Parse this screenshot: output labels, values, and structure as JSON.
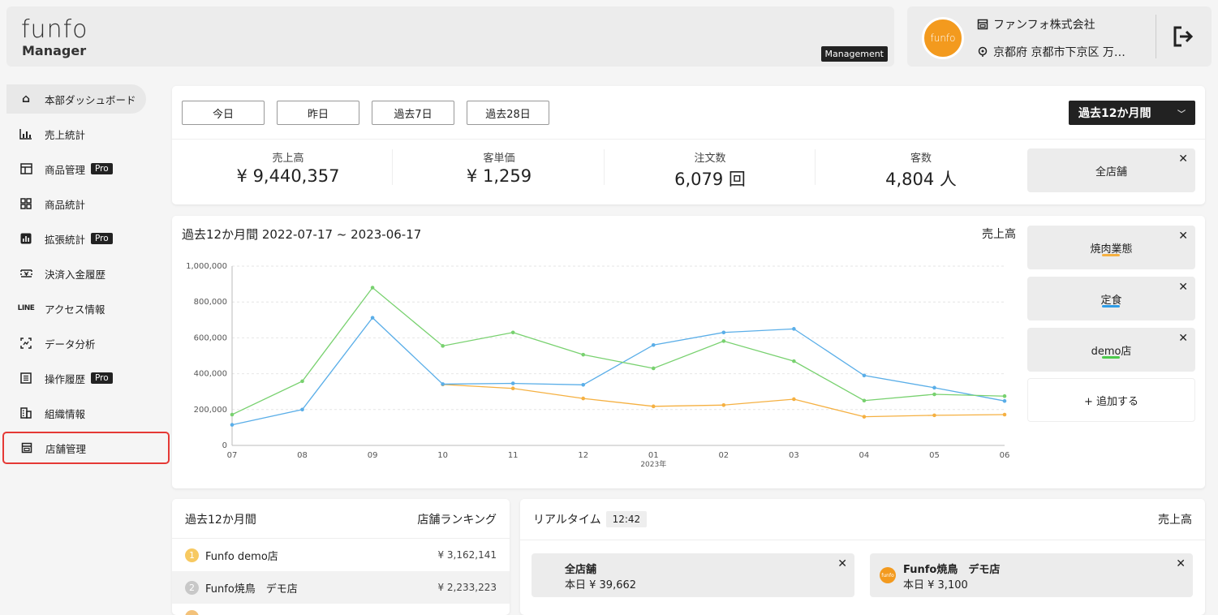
{
  "header": {
    "logo_text": "funfo",
    "logo_sub": "Manager",
    "badge": "Management",
    "avatar_text": "funfo",
    "company": "ファンフォ株式会社",
    "location": "京都府 京都市下京区 万…"
  },
  "sidebar": {
    "items": [
      {
        "label": "本部ダッシュボード",
        "icon": "home-icon"
      },
      {
        "label": "売上統計",
        "icon": "bar-chart-icon"
      },
      {
        "label": "商品管理",
        "icon": "layout-icon",
        "badge": "Pro"
      },
      {
        "label": "商品統計",
        "icon": "grid-icon"
      },
      {
        "label": "拡張統計",
        "icon": "stats-icon",
        "badge": "Pro"
      },
      {
        "label": "決済入金履歴",
        "icon": "payment-icon"
      },
      {
        "label": "アクセス情報",
        "icon": "line-icon",
        "icon_text": "LINE"
      },
      {
        "label": "データ分析",
        "icon": "analysis-icon"
      },
      {
        "label": "操作履歴",
        "icon": "list-icon",
        "badge": "Pro"
      },
      {
        "label": "組織情報",
        "icon": "building-icon"
      },
      {
        "label": "店舗管理",
        "icon": "store-icon"
      }
    ]
  },
  "filters": {
    "ranges": [
      "今日",
      "昨日",
      "過去7日",
      "過去28日"
    ],
    "period": "過去12か月間",
    "stats": [
      {
        "label": "売上高",
        "value": "¥ 9,440,357"
      },
      {
        "label": "客単価",
        "value": "¥ 1,259"
      },
      {
        "label": "注文数",
        "value": "6,079 回"
      },
      {
        "label": "客数",
        "value": "4,804 人"
      }
    ],
    "store_chip": "全店舗"
  },
  "chart_panel": {
    "title": "過去12か月間 2022-07-17 ~ 2023-06-17",
    "metric": "売上高",
    "chips": [
      {
        "label": "焼肉業態",
        "color": "#f5b041"
      },
      {
        "label": "定食",
        "color": "#2e9be6"
      },
      {
        "label": "demo店",
        "color": "#4cc94c"
      }
    ],
    "add_label": "+ 追加する"
  },
  "chart_data": {
    "type": "line",
    "categories": [
      "07",
      "08",
      "09",
      "10",
      "11",
      "12",
      "01",
      "02",
      "03",
      "04",
      "05",
      "06"
    ],
    "x_sublabel": {
      "index": 6,
      "text": "2023年"
    },
    "ylim": [
      0,
      1000000
    ],
    "yticks": [
      "0",
      "200,000",
      "400,000",
      "600,000",
      "800,000",
      "1,000,000"
    ],
    "grid": true,
    "series": [
      {
        "name": "焼肉業態",
        "color": "#f5b041",
        "start_index": 3,
        "values": [
          340000,
          318000,
          262000,
          218000,
          225000,
          258000,
          160000,
          168000,
          172000
        ]
      },
      {
        "name": "定食",
        "color": "#5aaee8",
        "start_index": 0,
        "values": [
          115000,
          200000,
          712000,
          342000,
          346000,
          338000,
          560000,
          630000,
          650000,
          390000,
          322000,
          248000
        ]
      },
      {
        "name": "demo店",
        "color": "#78d16f",
        "start_index": 0,
        "values": [
          172000,
          358000,
          880000,
          555000,
          630000,
          506000,
          430000,
          582000,
          470000,
          250000,
          285000,
          275000
        ]
      }
    ]
  },
  "ranking": {
    "period": "過去12か月間",
    "title": "店舗ランキング",
    "rows": [
      {
        "rank": "1",
        "name": "Funfo demo店",
        "amount": "¥ 3,162,141",
        "color": "#f7c961"
      },
      {
        "rank": "2",
        "name": "Funfo焼鳥　デモ店",
        "amount": "¥ 2,233,223",
        "color": "#c8c8c8"
      }
    ]
  },
  "realtime": {
    "title": "リアルタイム",
    "time": "12:42",
    "metric": "売上高",
    "stores": [
      {
        "name": "全店舗",
        "today": "本日 ¥ 39,662",
        "logo": false
      },
      {
        "name": "Funfo焼鳥　デモ店",
        "today": "本日 ¥ 3,100",
        "logo": true,
        "logo_text": "funfo"
      }
    ]
  }
}
